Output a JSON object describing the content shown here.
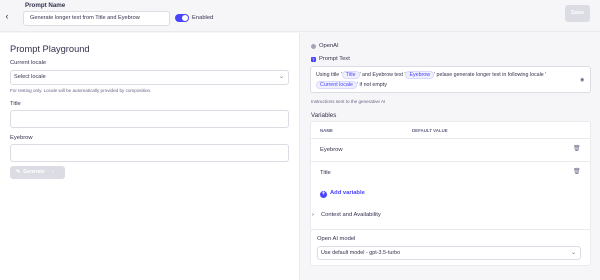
{
  "header": {
    "back_icon": "chevron-left-icon",
    "prompt_name_label": "Prompt Name",
    "prompt_name_value": "Generate longer text from Title and Eyebrow",
    "enabled_label": "Enabled",
    "enabled_state": true,
    "save_label": "Save"
  },
  "playground": {
    "title": "Prompt Playground",
    "locale_label": "Current locale",
    "locale_value": "Select locale",
    "locale_hint": "For testing only. Locale will be automatically provided by composition.",
    "title_label": "Title",
    "eyebrow_label": "Eyebrow",
    "generate_label": "Generate"
  },
  "config": {
    "provider_label": "OpenAI",
    "prompt_text_label": "Prompt Text",
    "prompt_parts": {
      "p1": "Using title '",
      "chip_title": "Title",
      "p2": "' and Eyebrow text '",
      "chip_eyebrow": "Eyebrow",
      "p3": "' pelase generate longer text in following locale '",
      "chip_locale": "Current locale",
      "p4": "' if not empty"
    },
    "instructions_hint": "Instructions sent to the generative AI",
    "variables_label": "Variables",
    "table_headers": {
      "name": "NAME",
      "default_value": "DEFAULT VALUE"
    },
    "variables": [
      {
        "name": "Eyebrow"
      },
      {
        "name": "Title"
      }
    ],
    "add_variable_label": "Add variable",
    "context_label": "Context and Availability",
    "model_label": "Open AI model",
    "model_value": "Use default model - gpt-3.5-turbo"
  },
  "colors": {
    "accent": "#4945ff",
    "background": "#f6f6f9",
    "border": "#dcdce4",
    "disabled": "#dcdce4"
  }
}
